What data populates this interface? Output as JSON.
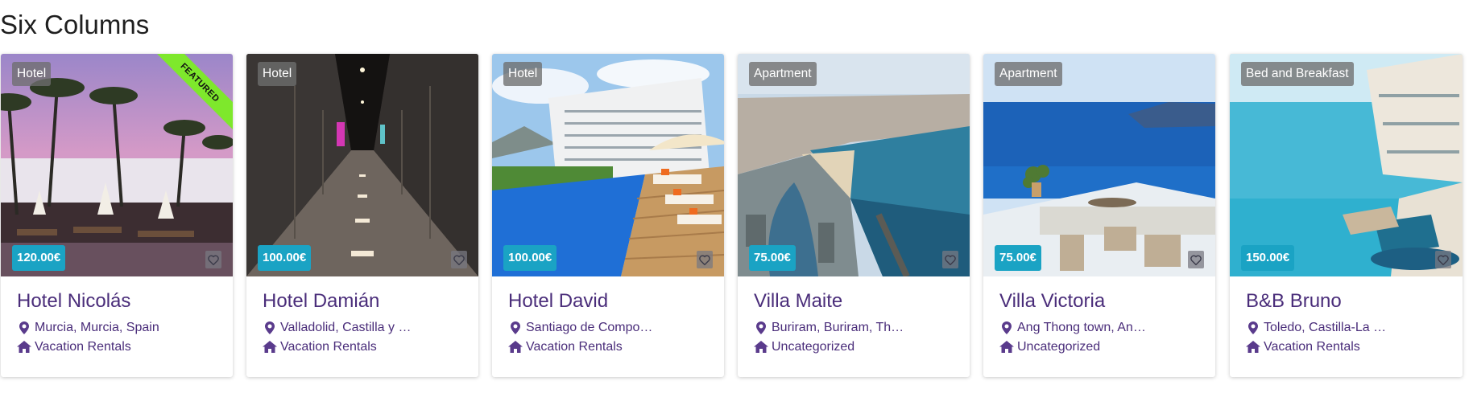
{
  "section": {
    "title": "Six Columns"
  },
  "colors": {
    "brand": "#4a2d7a",
    "price": "#1aa3c4",
    "featured": "#7ee82c",
    "badge": "#6e6e6e"
  },
  "icons": {
    "location": "map-marker-icon",
    "category": "home-icon",
    "favorite": "heart-icon"
  },
  "cards": [
    {
      "type": "Hotel",
      "price": "120.00€",
      "name": "Hotel Nicolás",
      "location": "Murcia, Murcia, Spain",
      "category": "Vacation Rentals",
      "featured": "FEATURED"
    },
    {
      "type": "Hotel",
      "price": "100.00€",
      "name": "Hotel Damián",
      "location": "Valladolid, Castilla y …",
      "category": "Vacation Rentals"
    },
    {
      "type": "Hotel",
      "price": "100.00€",
      "name": "Hotel David",
      "location": "Santiago de Compo…",
      "category": "Vacation Rentals"
    },
    {
      "type": "Apartment",
      "price": "75.00€",
      "name": "Villa Maite",
      "location": "Buriram, Buriram, Th…",
      "category": "Uncategorized"
    },
    {
      "type": "Apartment",
      "price": "75.00€",
      "name": "Villa Victoria",
      "location": "Ang Thong town, An…",
      "category": "Uncategorized"
    },
    {
      "type": "Bed and Breakfast",
      "price": "150.00€",
      "name": "B&B Bruno",
      "location": "Toledo, Castilla-La …",
      "category": "Vacation Rentals"
    }
  ]
}
